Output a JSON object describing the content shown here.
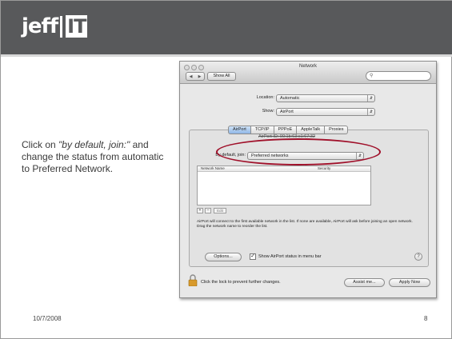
{
  "slide": {
    "logo_left": "jeff",
    "logo_right": "IT",
    "instruction_prefix": "Click on ",
    "instruction_italic": "\"by default, join:\"",
    "instruction_suffix": " and change the status from automatic to Preferred Network.",
    "date": "10/7/2008",
    "page_number": "8",
    "colors": {
      "header": "#58595b",
      "highlight_ring": "#a0102a"
    }
  },
  "window": {
    "title": "Network",
    "toolbar": {
      "back_forward": [
        "◀",
        "▶"
      ],
      "show_all": "Show All",
      "search_icon": "magnifier-icon"
    },
    "location": {
      "label": "Location:",
      "value": "Automatic"
    },
    "show": {
      "label": "Show:",
      "value": "AirPort"
    },
    "tabs": [
      "AirPort",
      "TCP/IP",
      "PPPoE",
      "AppleTalk",
      "Proxies"
    ],
    "active_tab": "AirPort",
    "airport_id": "AirPort ID:   00:1b:63:c1:67:32",
    "by_default": {
      "label": "By default, join:",
      "value": "Preferred networks"
    },
    "network_list": {
      "columns": [
        "Network Name",
        "Security"
      ],
      "rows": []
    },
    "list_buttons": {
      "add": "+",
      "remove": "–",
      "edit": "Edit"
    },
    "help_text": "AirPort will connect to the first available network in the list. If none are available, AirPort will ask before joining an open network. Drag the network name to reorder the list.",
    "options_button": "Options...",
    "show_status_checkbox": {
      "label": "Show AirPort status in menu bar",
      "checked": true
    },
    "help_button": "?",
    "lock_text": "Click the lock to prevent further changes.",
    "assist_button": "Assist me...",
    "apply_button": "Apply Now"
  }
}
